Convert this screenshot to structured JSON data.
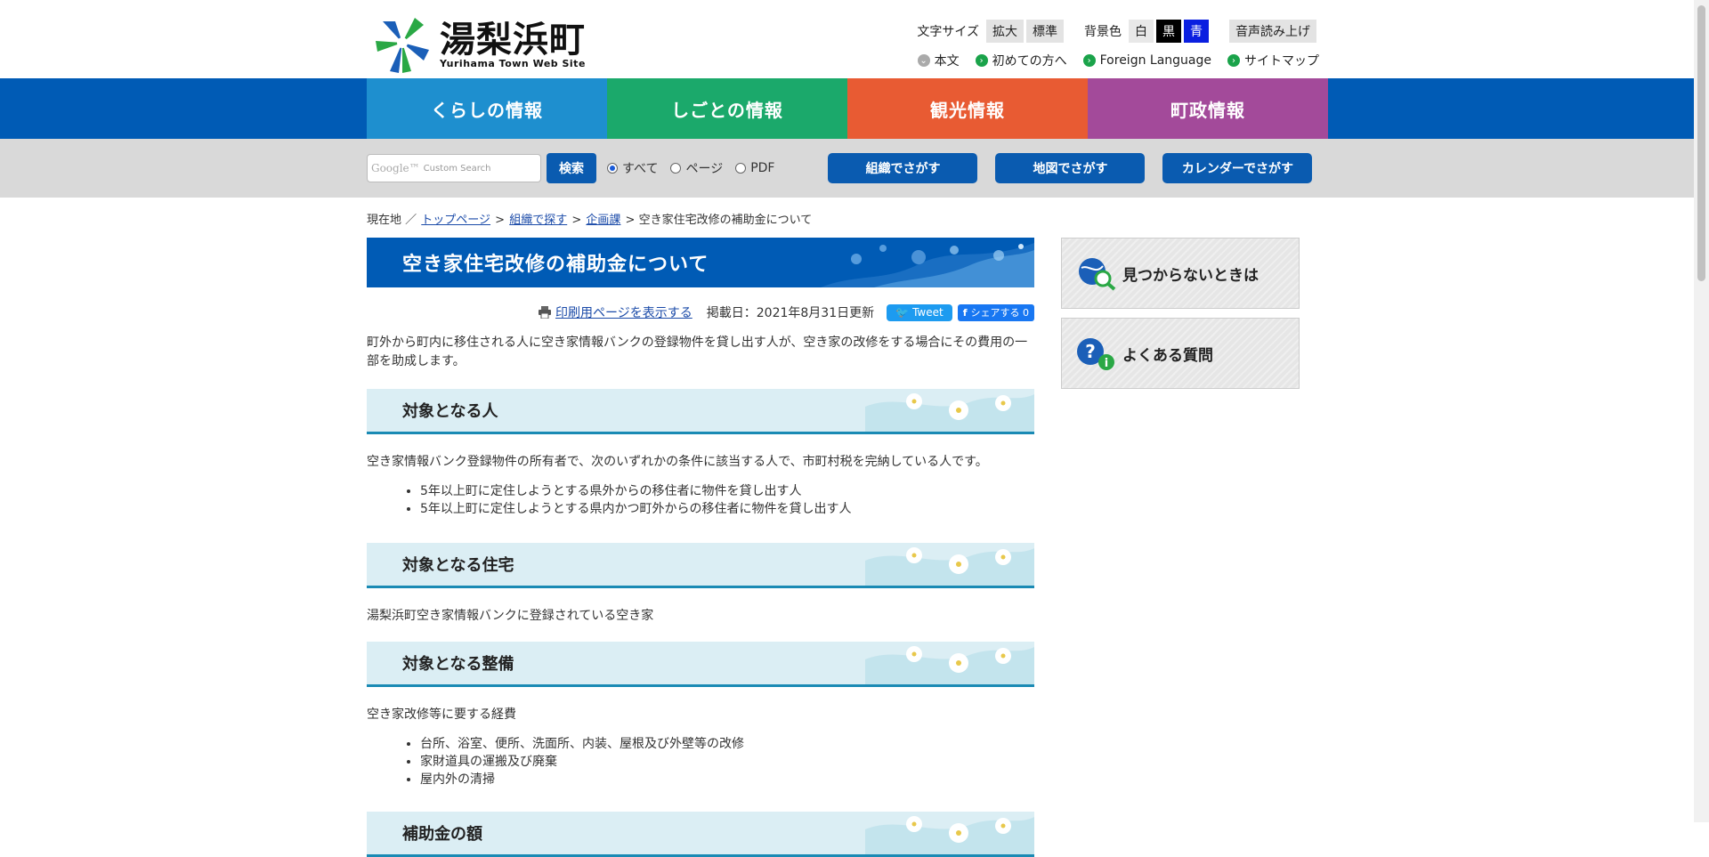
{
  "site": {
    "name": "湯梨浜町",
    "subtitle": "Yurihama Town  Web Site"
  },
  "utility": {
    "font_size_label": "文字サイズ",
    "enlarge": "拡大",
    "standard": "標準",
    "bg_label": "背景色",
    "bg_white": "白",
    "bg_black": "黒",
    "bg_blue": "青",
    "voice": "音声読み上げ",
    "links": [
      {
        "label": "本文"
      },
      {
        "label": "初めての方へ"
      },
      {
        "label": "Foreign Language"
      },
      {
        "label": "サイトマップ"
      }
    ]
  },
  "nav": [
    {
      "label": "くらしの情報",
      "color": "#1e8fcf"
    },
    {
      "label": "しごとの情報",
      "color": "#1ba96b"
    },
    {
      "label": "観光情報",
      "color": "#e85b33"
    },
    {
      "label": "町政情報",
      "color": "#a34a9a"
    }
  ],
  "search": {
    "google_label": "Google™",
    "placeholder": "Custom Search",
    "button": "検索",
    "radios": [
      {
        "label": "すべて",
        "selected": true
      },
      {
        "label": "ページ",
        "selected": false
      },
      {
        "label": "PDF",
        "selected": false
      }
    ],
    "buttons": [
      {
        "label": "組織でさがす"
      },
      {
        "label": "地図でさがす"
      },
      {
        "label": "カレンダーでさがす"
      }
    ]
  },
  "breadcrumb": {
    "prefix": "現在地 ／",
    "links": [
      "トップページ",
      "組織で探す",
      "企画課"
    ],
    "current": "空き家住宅改修の補助金について"
  },
  "page": {
    "title": "空き家住宅改修の補助金について",
    "print_link": "印刷用ページを表示する",
    "date": "掲載日：2021年8月31日更新",
    "tweet": "Tweet",
    "share": "シェアする 0",
    "lead": "町外から町内に移住される人に空き家情報バンクの登録物件を貸し出す人が、空き家の改修をする場合にその費用の一部を助成します。",
    "sections": [
      {
        "heading": "対象となる人",
        "text": "空き家情報バンク登録物件の所有者で、次のいずれかの条件に該当する人で、市町村税を完納している人です。",
        "items": [
          "5年以上町に定住しようとする県外からの移住者に物件を貸し出す人",
          "5年以上町に定住しようとする県内かつ町外からの移住者に物件を貸し出す人"
        ]
      },
      {
        "heading": "対象となる住宅",
        "text": "湯梨浜町空き家情報バンクに登録されている空き家",
        "items": []
      },
      {
        "heading": "対象となる整備",
        "text": "空き家改修等に要する経費",
        "items": [
          "台所、浴室、便所、洗面所、内装、屋根及び外壁等の改修",
          "家財道具の運搬及び廃棄",
          "屋内外の清掃"
        ]
      },
      {
        "heading": "補助金の額",
        "text": "",
        "items": []
      }
    ]
  },
  "sidebar": [
    {
      "label": "見つからないときは",
      "icon": "magnifier-globe-icon"
    },
    {
      "label": "よくある質問",
      "icon": "question-info-icon"
    }
  ]
}
